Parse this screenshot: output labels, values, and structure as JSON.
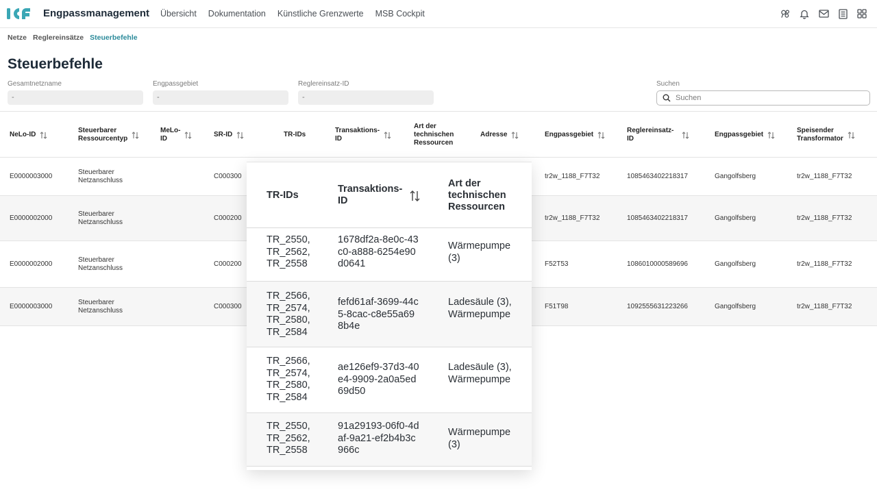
{
  "app": {
    "title": "Engpassmanagement",
    "accent": "#2b8a9a"
  },
  "nav": {
    "items": [
      "Übersicht",
      "Dokumentation",
      "Künstliche Grenzwerte",
      "MSB Cockpit"
    ]
  },
  "top_icons": [
    "network-icon",
    "bell-icon",
    "mail-icon",
    "document-icon",
    "grid-icon"
  ],
  "breadcrumb": [
    "Netze",
    "Reglereinsätze",
    "Steuerbefehle"
  ],
  "page": {
    "title": "Steuerbefehle"
  },
  "filters": {
    "gesamtnetzname": {
      "label": "Gesamtnetzname",
      "value": "-"
    },
    "engpassgebiet": {
      "label": "Engpassgebiet",
      "value": "-"
    },
    "reglereinsatz": {
      "label": "Reglereinsatz-ID",
      "value": "-"
    },
    "search": {
      "label": "Suchen",
      "placeholder": "Suchen"
    }
  },
  "table": {
    "headers": {
      "nelo": "NeLo-ID",
      "ressourcentyp": "Steuerbarer Ressourcentyp",
      "melo": "MeLo-ID",
      "sr": "SR-ID",
      "tr": "TR-IDs",
      "transaktion": "Transaktions-ID",
      "art": "Art der technischen Ressourcen",
      "adresse": "Adresse",
      "engpass1": "Engpassgebiet",
      "regler": "Reglereinsatz-ID",
      "engpass2": "Engpassgebiet",
      "trafo": "Speisender Transformator"
    },
    "rows": [
      {
        "nelo": "E0000003000",
        "typ": "Steuerbarer Netzanschluss",
        "sr": "C000300",
        "engpass1": "tr2w_1188_F7T32",
        "regler": "1085463402218317",
        "engpass2": "Gangolfsberg",
        "trafo": "tr2w_1188_F7T32"
      },
      {
        "nelo": "E0000002000",
        "typ": "Steuerbarer Netzanschluss",
        "sr": "C000200",
        "engpass1": "tr2w_1188_F7T32",
        "regler": "1085463402218317",
        "engpass2": "Gangolfsberg",
        "trafo": "tr2w_1188_F7T32"
      },
      {
        "nelo": "E0000002000",
        "typ": "Steuerbarer Netzanschluss",
        "sr": "C000200",
        "engpass1": "F52T53",
        "regler": "1086010000589696",
        "engpass2": "Gangolfsberg",
        "trafo": "tr2w_1188_F7T32"
      },
      {
        "nelo": "E0000003000",
        "typ": "Steuerbarer Netzanschluss",
        "sr": "C000300",
        "engpass1": "F51T98",
        "regler": "1092555631223266",
        "engpass2": "Gangolfsberg",
        "trafo": "tr2w_1188_F7T32"
      }
    ]
  },
  "zoom": {
    "headers": {
      "tr": "TR-IDs",
      "transaktion": "Transaktions-ID",
      "art": "Art der technischen Ressourcen"
    },
    "rows": [
      {
        "tr": "TR_2550, TR_2562, TR_2558",
        "transaktion": "1678df2a-8e0c-43c0-a888-6254e90d0641",
        "art": "Wärmepumpe (3)"
      },
      {
        "tr": "TR_2566, TR_2574, TR_2580, TR_2584",
        "transaktion": "fefd61af-3699-44c5-8cac-c8e55a698b4e",
        "art": "Ladesäule (3), Wärmepumpe"
      },
      {
        "tr": "TR_2566, TR_2574, TR_2580, TR_2584",
        "transaktion": "ae126ef9-37d3-40e4-9909-2a0a5ed69d50",
        "art": "Ladesäule (3), Wärmepumpe"
      },
      {
        "tr": "TR_2550, TR_2562, TR_2558",
        "transaktion": "91a29193-06f0-4daf-9a21-ef2b4b3c966c",
        "art": "Wärmepumpe (3)"
      }
    ]
  }
}
